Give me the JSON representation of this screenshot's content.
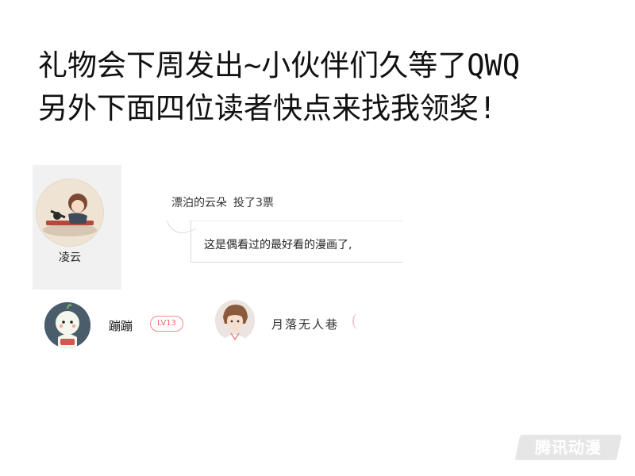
{
  "headline": {
    "line1": "礼物会下周发出~小伙伴们久等了QWQ",
    "line2": "另外下面四位读者快点来找我领奖!"
  },
  "winners": [
    {
      "name": "凌云"
    },
    {
      "name": "蹦蹦",
      "level": "LV13"
    },
    {
      "name": "月落无人巷"
    }
  ],
  "comment": {
    "user": "漂泊的云朵",
    "action": "投了3票",
    "text": "这是偶看过的最好看的漫画了,"
  },
  "watermark": {
    "text": "腾讯动漫"
  },
  "colors": {
    "badge": "#e86a6a",
    "card_bg": "#f1f1f1"
  }
}
